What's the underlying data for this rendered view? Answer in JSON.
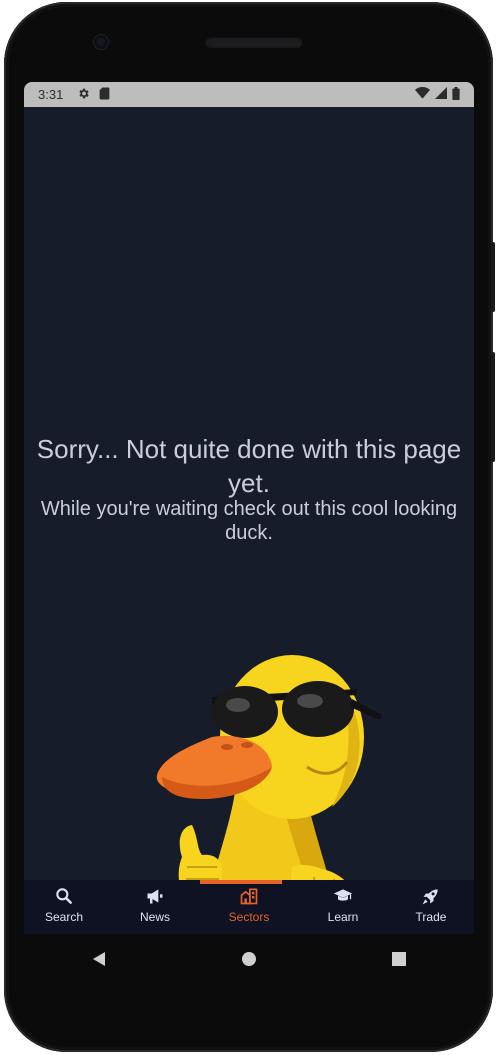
{
  "status_bar": {
    "time": "3:31",
    "icons_left": [
      "gear-icon",
      "sd-card-icon"
    ],
    "icons_right": [
      "wifi-icon",
      "signal-icon",
      "battery-icon"
    ]
  },
  "message": {
    "title": "Sorry... Not quite done with this page yet.",
    "subtitle": "While you're waiting check out this cool looking duck."
  },
  "illustration": {
    "name": "cartoon duck with sunglasses giving thumbs up"
  },
  "bottom_nav": {
    "active": "Sectors",
    "accent_color": "#e5622a",
    "items": [
      {
        "label": "Search",
        "icon": "search-icon"
      },
      {
        "label": "News",
        "icon": "megaphone-icon"
      },
      {
        "label": "Sectors",
        "icon": "buildings-icon"
      },
      {
        "label": "Learn",
        "icon": "graduation-cap-icon"
      },
      {
        "label": "Trade",
        "icon": "rocket-icon"
      }
    ]
  },
  "system_nav": [
    "back-icon",
    "home-icon",
    "recents-icon"
  ]
}
